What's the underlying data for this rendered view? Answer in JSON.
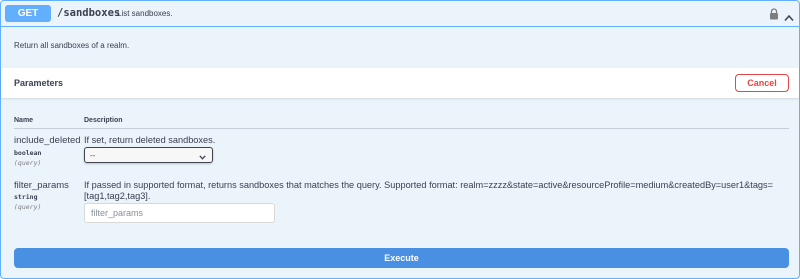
{
  "operation": {
    "method": "GET",
    "path": "/sandboxes",
    "summary": "List sandboxes.",
    "description": "Return all sandboxes of a realm.",
    "icons": {
      "lock": "lock-icon",
      "collapse": "chevron-up-icon"
    }
  },
  "parameters_section": {
    "title": "Parameters",
    "cancel_label": "Cancel",
    "columns": {
      "name": "Name",
      "description": "Description"
    }
  },
  "params": [
    {
      "name": "include_deleted",
      "type": "boolean",
      "in": "(query)",
      "description": "If set, return deleted sandboxes.",
      "select_value": "--"
    },
    {
      "name": "filter_params",
      "type": "string",
      "in": "(query)",
      "description_line1": "If passed in supported format, returns sandboxes that matches the query. Supported format: realm=zzzz&state=active&resourceProfile=medium&createdBy=user1&tags=",
      "description_line2": "[tag1,tag2,tag3].",
      "placeholder": "filter_params"
    }
  ],
  "execute_label": "Execute",
  "colors": {
    "get_blue": "#61affe",
    "block_bg": "#ebf3fb",
    "cancel_red": "#e24646",
    "execute_blue": "#4990e2"
  }
}
